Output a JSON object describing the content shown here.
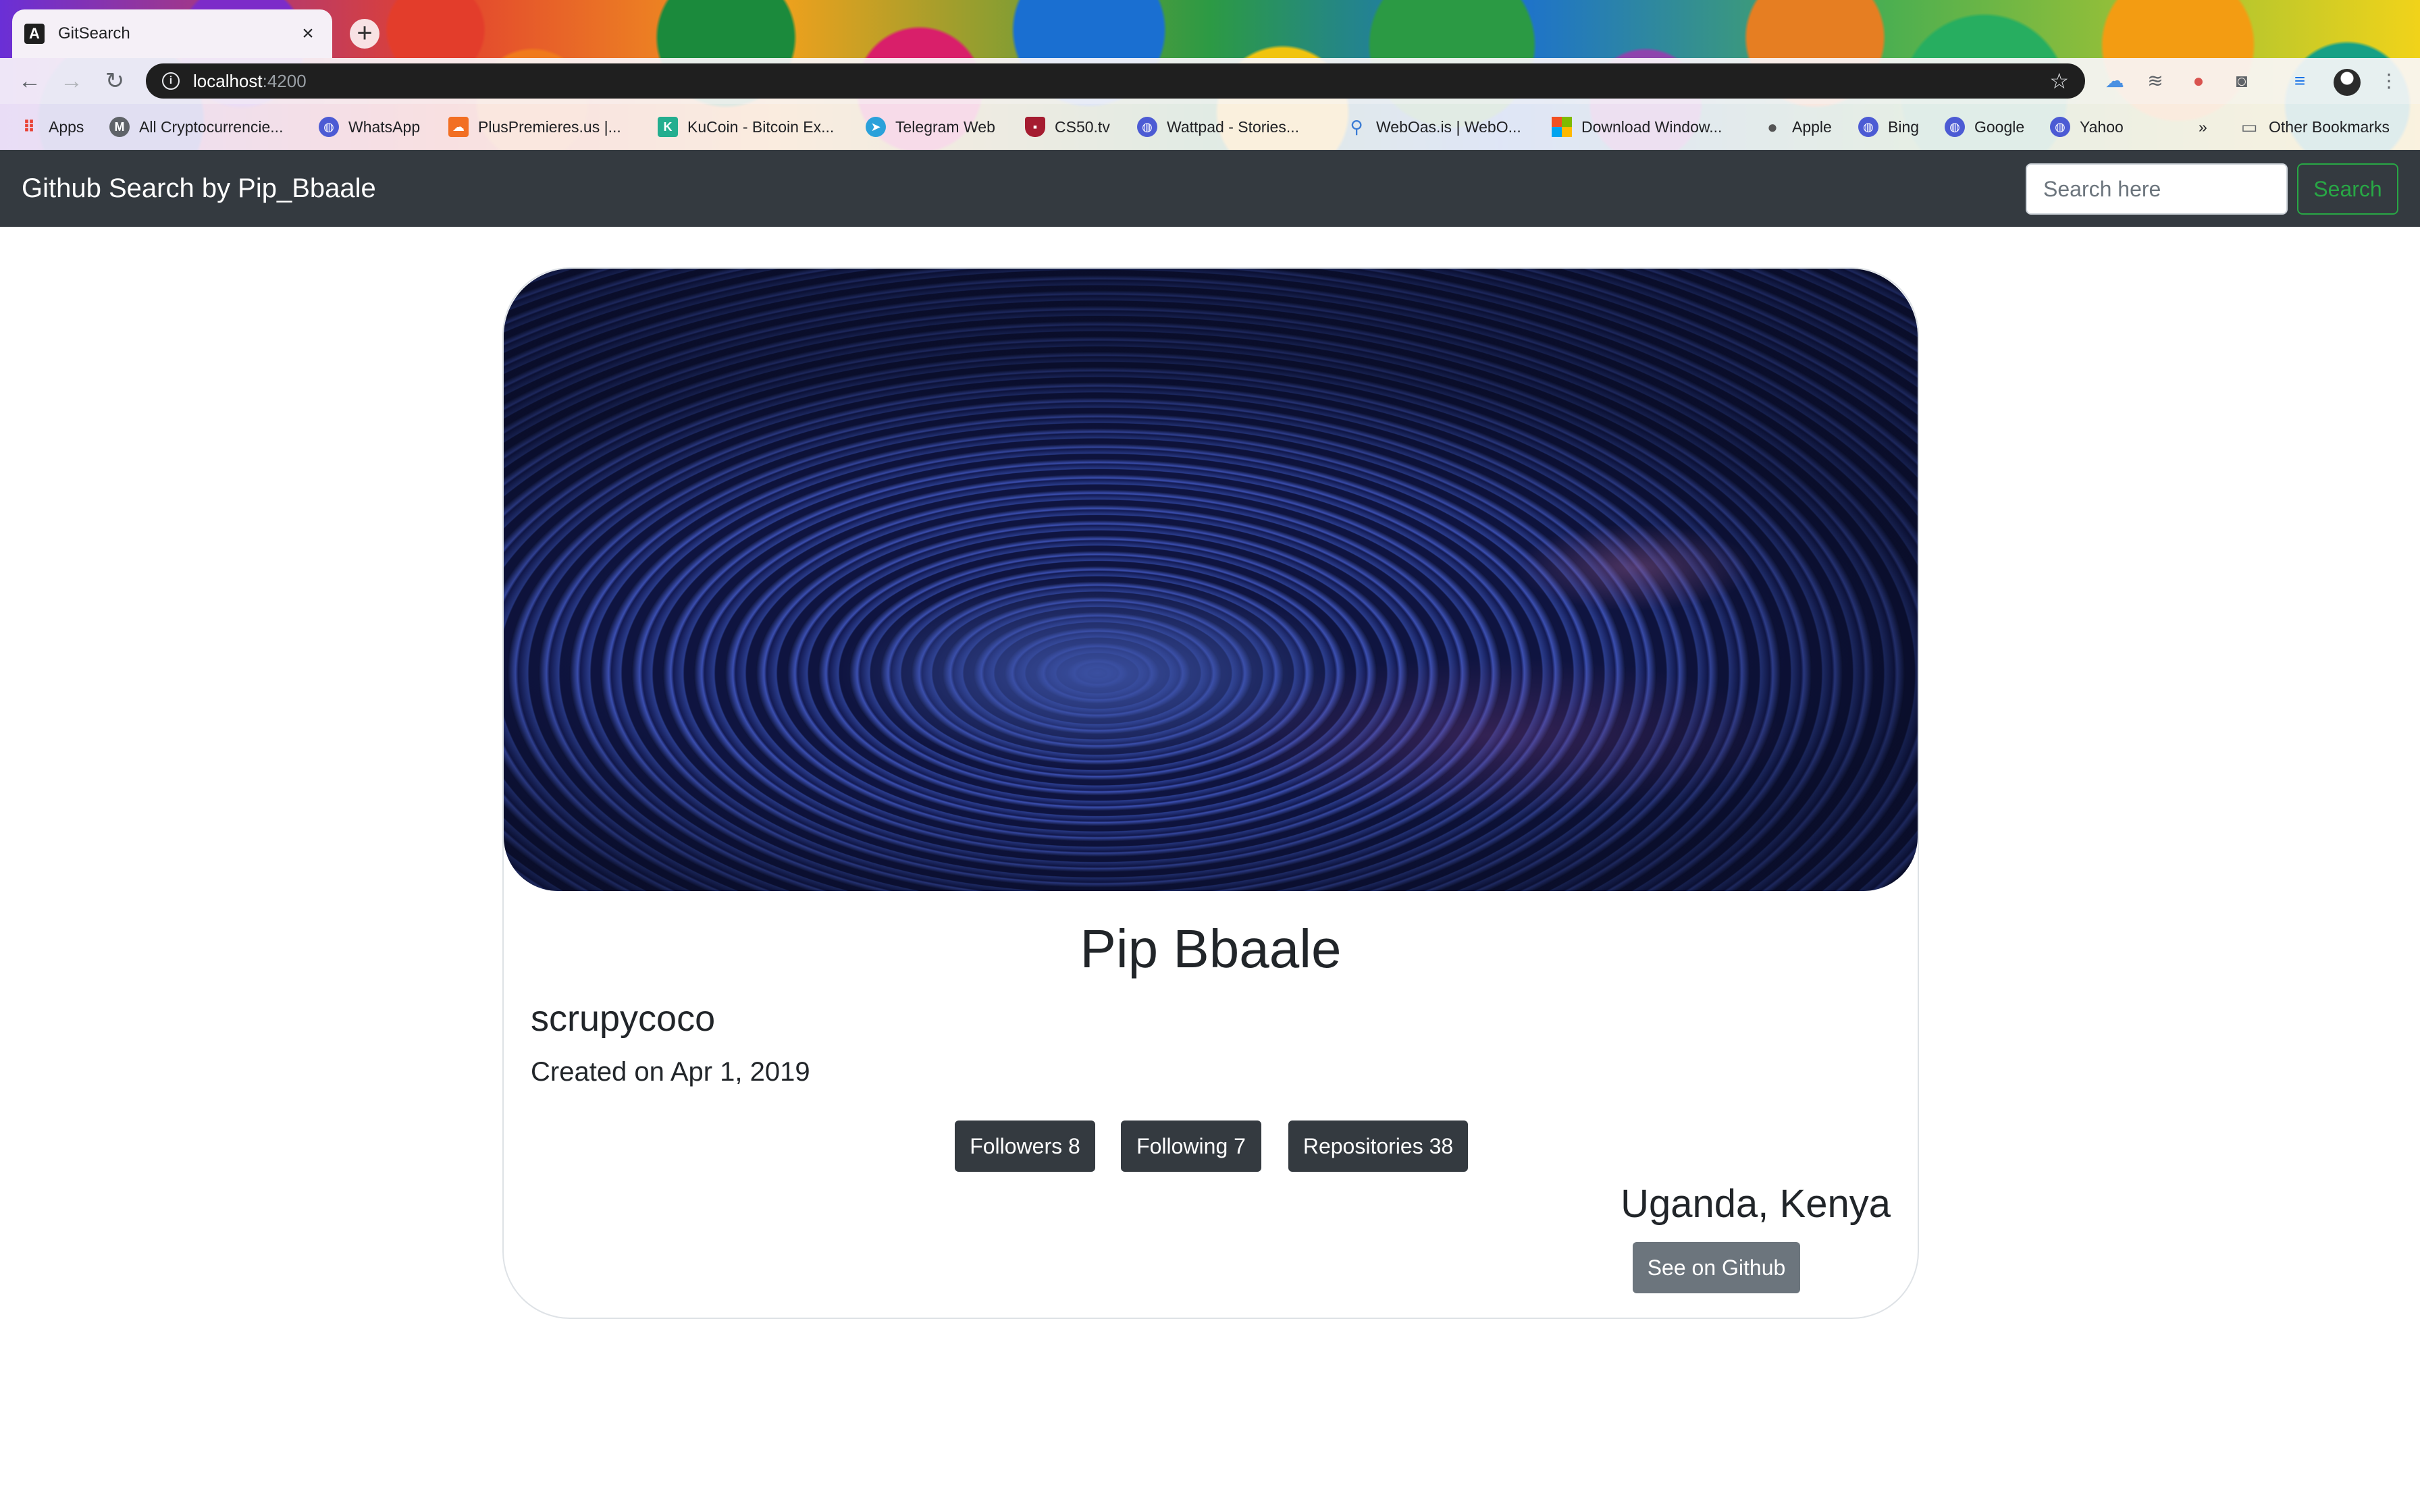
{
  "browser": {
    "tab_title": "GitSearch",
    "tab_favicon_letter": "A",
    "url_host": "localhost",
    "url_port": ":4200",
    "bookmarks": [
      {
        "label": "Apps",
        "icon": "apps-grid-icon"
      },
      {
        "label": "All Cryptocurrencie...",
        "icon": "coinmarketcap-icon"
      },
      {
        "label": "WhatsApp",
        "icon": "globe-icon"
      },
      {
        "label": "PlusPremieres.us |...",
        "icon": "soundcloud-icon"
      },
      {
        "label": "KuCoin - Bitcoin Ex...",
        "icon": "kucoin-icon"
      },
      {
        "label": "Telegram Web",
        "icon": "telegram-icon"
      },
      {
        "label": "CS50.tv",
        "icon": "harvard-shield-icon"
      },
      {
        "label": "Wattpad - Stories...",
        "icon": "globe-icon"
      },
      {
        "label": "WebOas.is | WebO...",
        "icon": "weboasis-icon"
      },
      {
        "label": "Download Window...",
        "icon": "windows-icon"
      },
      {
        "label": "Apple",
        "icon": "apple-icon"
      },
      {
        "label": "Bing",
        "icon": "globe-icon"
      },
      {
        "label": "Google",
        "icon": "globe-icon"
      },
      {
        "label": "Yahoo",
        "icon": "globe-icon"
      }
    ],
    "overflow_label": "»",
    "other_bookmarks": "Other Bookmarks"
  },
  "navbar": {
    "brand": "Github Search by Pip_Bbaale",
    "search_placeholder": "Search here",
    "search_button": "Search",
    "accent": "#28a745",
    "background": "#343a40"
  },
  "profile": {
    "name": "Pip Bbaale",
    "username": "scrupycoco",
    "created": "Created on Apr 1, 2019",
    "followers": "Followers 8",
    "following": "Following 7",
    "repositories": "Repositories 38",
    "location": "Uganda, Kenya",
    "github_button": "See on Github"
  }
}
